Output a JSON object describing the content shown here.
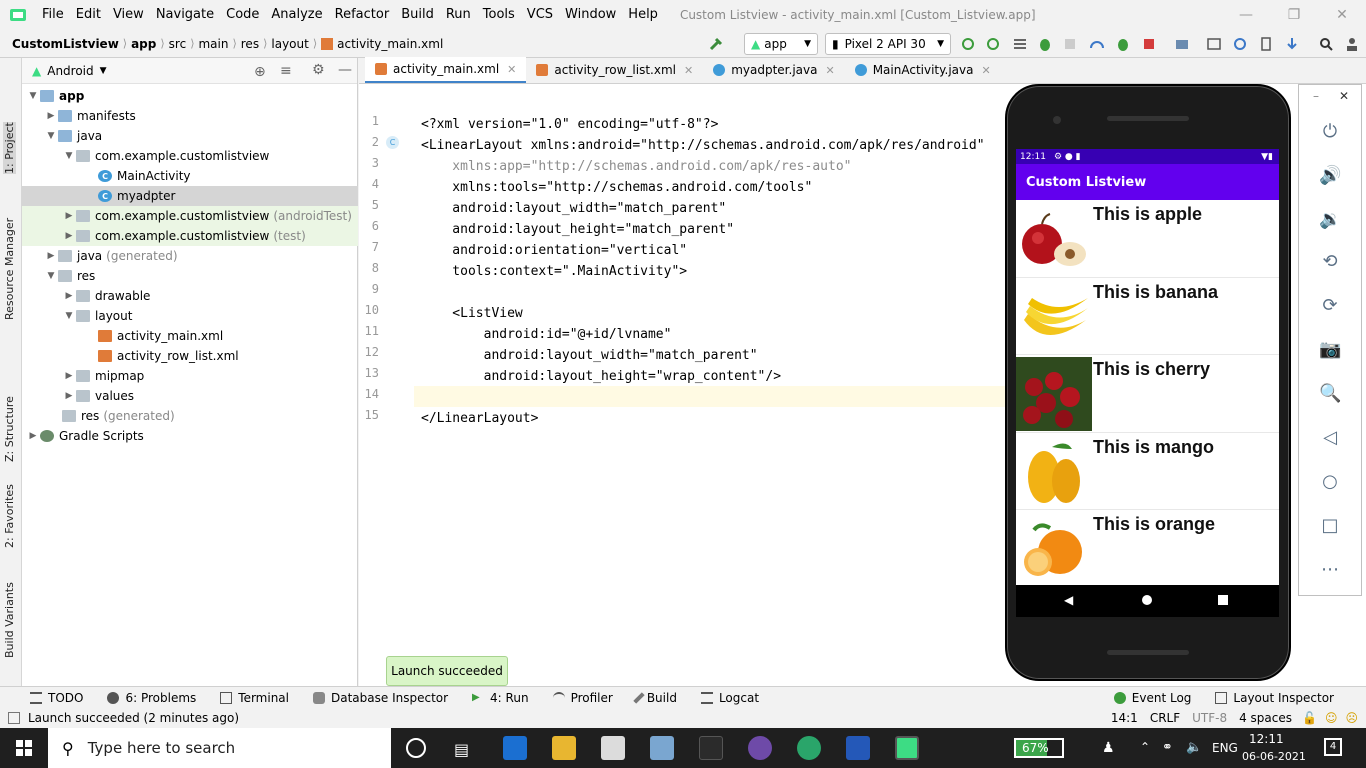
{
  "menubar": {
    "items": [
      "File",
      "Edit",
      "View",
      "Navigate",
      "Code",
      "Analyze",
      "Refactor",
      "Build",
      "Run",
      "Tools",
      "VCS",
      "Window",
      "Help"
    ],
    "window_title": "Custom Listview - activity_main.xml [Custom_Listview.app]"
  },
  "navbar": {
    "breadcrumbs": [
      "CustomListview",
      "app",
      "src",
      "main",
      "res",
      "layout",
      "activity_main.xml"
    ],
    "run_config": "app",
    "device": "Pixel 2 API 30"
  },
  "project": {
    "view_mode": "Android",
    "tree": [
      {
        "label": "app",
        "muted": ""
      },
      {
        "label": "manifests",
        "muted": ""
      },
      {
        "label": "java",
        "muted": ""
      },
      {
        "label": "com.example.customlistview",
        "muted": ""
      },
      {
        "label": "MainActivity",
        "muted": ""
      },
      {
        "label": "myadpter",
        "muted": ""
      },
      {
        "label": "com.example.customlistview",
        "muted": "(androidTest)"
      },
      {
        "label": "com.example.customlistview",
        "muted": "(test)"
      },
      {
        "label": "java",
        "muted": "(generated)"
      },
      {
        "label": "res",
        "muted": ""
      },
      {
        "label": "drawable",
        "muted": ""
      },
      {
        "label": "layout",
        "muted": ""
      },
      {
        "label": "activity_main.xml",
        "muted": ""
      },
      {
        "label": "activity_row_list.xml",
        "muted": ""
      },
      {
        "label": "mipmap",
        "muted": ""
      },
      {
        "label": "values",
        "muted": ""
      },
      {
        "label": "res",
        "muted": "(generated)"
      },
      {
        "label": "Gradle Scripts",
        "muted": ""
      }
    ]
  },
  "left_stripe": {
    "labels": [
      "1: Project",
      "Resource Manager",
      "Z: Structure",
      "2: Favorites",
      "Build Variants"
    ]
  },
  "tabs": [
    "activity_main.xml",
    "activity_row_list.xml",
    "myadpter.java",
    "MainActivity.java"
  ],
  "code": {
    "line_numbers": [
      "1",
      "2",
      "3",
      "4",
      "5",
      "6",
      "7",
      "8",
      "9",
      "10",
      "11",
      "12",
      "13",
      "14",
      "15"
    ],
    "lines": [
      "<?xml version=\"1.0\" encoding=\"utf-8\"?>",
      "<LinearLayout xmlns:android=\"http://schemas.android.com/apk/res/android\"",
      "    xmlns:app=\"http://schemas.android.com/apk/res-auto\"",
      "    xmlns:tools=\"http://schemas.android.com/tools\"",
      "    android:layout_width=\"match_parent\"",
      "    android:layout_height=\"match_parent\"",
      "    android:orientation=\"vertical\"",
      "    tools:context=\".MainActivity\">",
      "",
      "    <ListView",
      "        android:id=\"@+id/lvname\"",
      "        android:layout_width=\"match_parent\"",
      "        android:layout_height=\"wrap_content\"/>",
      "",
      "</LinearLayout>"
    ]
  },
  "phone": {
    "status_time": "12:11",
    "app_title": "Custom Listview",
    "rows": [
      {
        "text": "This is apple",
        "fruit": "apple"
      },
      {
        "text": "This is banana",
        "fruit": "banana"
      },
      {
        "text": "This is cherry",
        "fruit": "cherry"
      },
      {
        "text": "This is mango",
        "fruit": "mango"
      },
      {
        "text": "This is orange",
        "fruit": "orange"
      }
    ]
  },
  "bottom_tools": {
    "left": [
      "TODO",
      "6: Problems",
      "Terminal",
      "Database Inspector",
      "4: Run",
      "Profiler",
      "Build",
      "Logcat"
    ],
    "right": [
      "Event Log",
      "Layout Inspector"
    ]
  },
  "toast": "Launch succeeded",
  "status": {
    "message": "Launch succeeded (2 minutes ago)",
    "position": "14:1",
    "line_sep": "CRLF",
    "encoding": "UTF-8",
    "indent": "4 spaces"
  },
  "taskbar": {
    "search_placeholder": "Type here to search",
    "battery": "67%",
    "lang": "ENG",
    "time": "12:11",
    "date": "06-06-2021",
    "notifications": "4"
  },
  "colors": {
    "accent": "#6200ee",
    "status_purple": "#3700b3",
    "tag_blue": "#000080",
    "attr_purple": "#871094",
    "value_green": "#067d17"
  }
}
